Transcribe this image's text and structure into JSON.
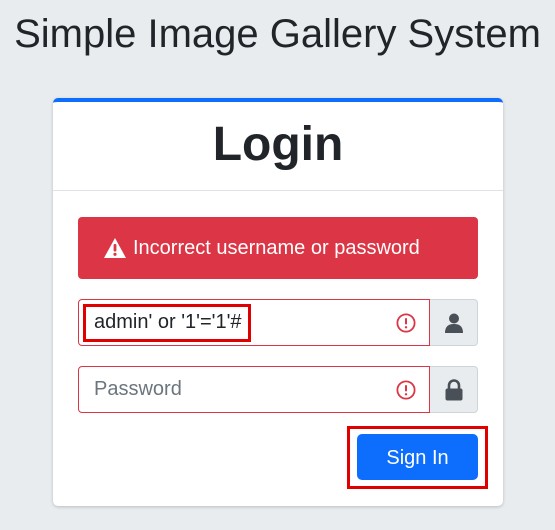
{
  "page": {
    "site_title": "Simple Image Gallery System"
  },
  "card": {
    "title": "Login"
  },
  "alert": {
    "message": "Incorrect username or password",
    "icon": "warning-triangle-icon"
  },
  "username": {
    "value": "admin' or '1'='1'#",
    "error_icon": "exclamation-circle-icon",
    "addon_icon": "user-icon"
  },
  "password": {
    "placeholder": "Password",
    "error_icon": "exclamation-circle-icon",
    "addon_icon": "lock-icon"
  },
  "form": {
    "submit_label": "Sign In"
  },
  "colors": {
    "accent": "#0d6efd",
    "danger": "#dc3545",
    "highlight": "#e00000"
  }
}
